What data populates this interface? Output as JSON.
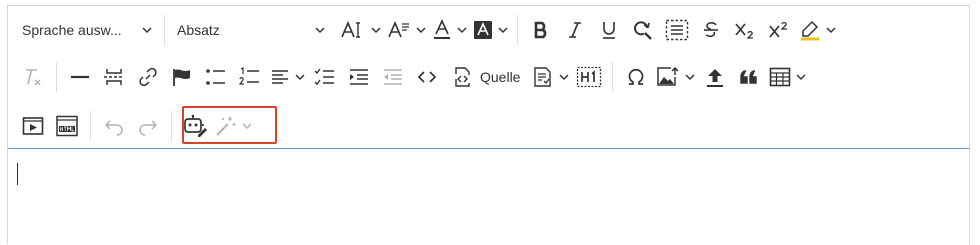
{
  "toolbar": {
    "style_select": {
      "value": "Sprache ausw..."
    },
    "format_select": {
      "value": "Absatz"
    },
    "source_button": {
      "label": "Quelle"
    }
  },
  "editor": {
    "content": ""
  },
  "colors": {
    "highlight_border": "#d9432b",
    "editor_focus_border": "#5aa6d6",
    "icon": "#333333",
    "icon_disabled": "#b3b3b3"
  }
}
